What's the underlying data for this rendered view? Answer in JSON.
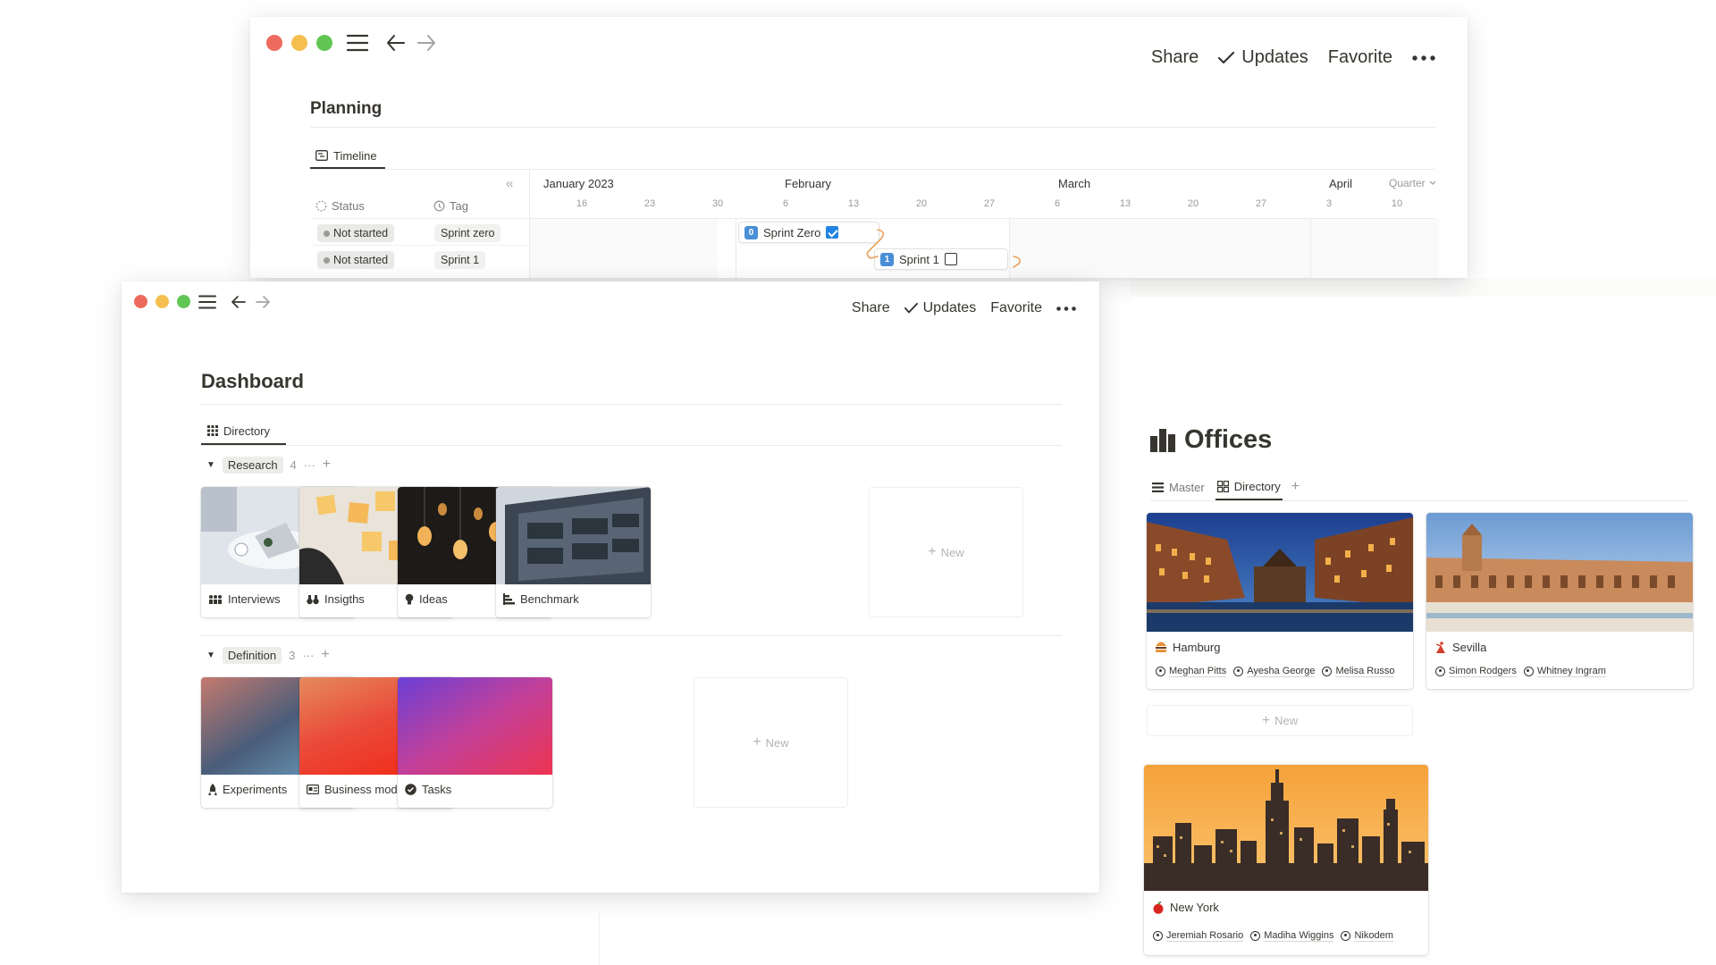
{
  "header": {
    "share_label": "Share",
    "updates_label": "Updates",
    "favorite_label": "Favorite"
  },
  "planning": {
    "title": "Planning",
    "tab_label": "Timeline",
    "columns": {
      "status": "Status",
      "tag": "Tag"
    },
    "rows": [
      {
        "status": "Not started",
        "tag": "Sprint zero"
      },
      {
        "status": "Not started",
        "tag": "Sprint 1"
      }
    ],
    "timeline": {
      "months": [
        "January 2023",
        "February",
        "March",
        "April"
      ],
      "days": [
        "16",
        "23",
        "30",
        "6",
        "13",
        "20",
        "27",
        "6",
        "13",
        "20",
        "27",
        "3",
        "10"
      ],
      "view_mode": "Quarter",
      "tasks": [
        {
          "badge": "0",
          "label": "Sprint Zero",
          "checked": true
        },
        {
          "badge": "1",
          "label": "Sprint 1",
          "checked": false
        }
      ]
    }
  },
  "dashboard": {
    "title": "Dashboard",
    "tab_label": "Directory",
    "groups": [
      {
        "name": "Research",
        "count": "4",
        "cards": [
          "Interviews",
          "Insigths",
          "Ideas",
          "Benchmark"
        ]
      },
      {
        "name": "Definition",
        "count": "3",
        "cards": [
          "Experiments",
          "Business model",
          "Tasks"
        ]
      }
    ],
    "new_label": "New"
  },
  "offices": {
    "title": "Offices",
    "tabs": [
      "Master",
      "Directory"
    ],
    "cards": [
      {
        "name": "Hamburg",
        "people": [
          "Meghan Pitts",
          "Ayesha George",
          "Melisa Russo"
        ]
      },
      {
        "name": "Sevilla",
        "people": [
          "Simon Rodgers",
          "Whitney Ingram"
        ]
      },
      {
        "name": "New York",
        "people": [
          "Jeremiah Rosario",
          "Madiha Wiggins",
          "Nikodem"
        ]
      }
    ],
    "new_label": "New"
  }
}
